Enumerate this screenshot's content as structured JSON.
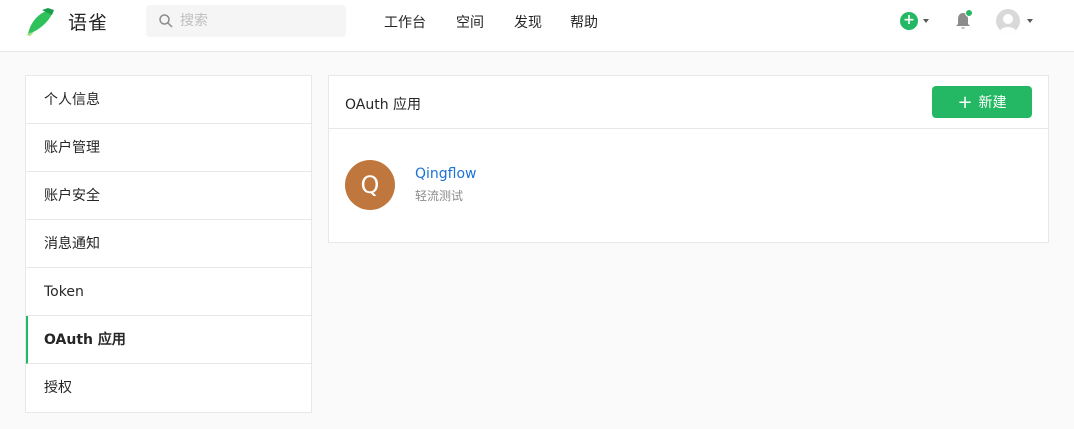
{
  "header": {
    "brand": "语雀",
    "search_placeholder": "搜索",
    "nav": [
      {
        "label": "工作台"
      },
      {
        "label": "空间"
      },
      {
        "label": "发现"
      },
      {
        "label": "帮助"
      }
    ],
    "add_symbol": "+"
  },
  "sidebar": {
    "items": [
      {
        "label": "个人信息"
      },
      {
        "label": "账户管理"
      },
      {
        "label": "账户安全"
      },
      {
        "label": "消息通知"
      },
      {
        "label": "Token"
      },
      {
        "label": "OAuth 应用",
        "active": true
      },
      {
        "label": "授权"
      }
    ]
  },
  "main": {
    "title": "OAuth 应用",
    "new_button_icon": "+",
    "new_button_label": "新建",
    "apps": [
      {
        "initial": "Q",
        "name": "Qingflow",
        "description": "轻流测试"
      }
    ]
  },
  "colors": {
    "accent": "#25b864",
    "link": "#1b73d3",
    "app_avatar": "#c0773d"
  },
  "icons": [
    "yuque-logo-icon",
    "search-icon",
    "plus-circle-icon",
    "chevron-down-icon",
    "bell-icon",
    "user-avatar-icon",
    "plus-icon"
  ]
}
